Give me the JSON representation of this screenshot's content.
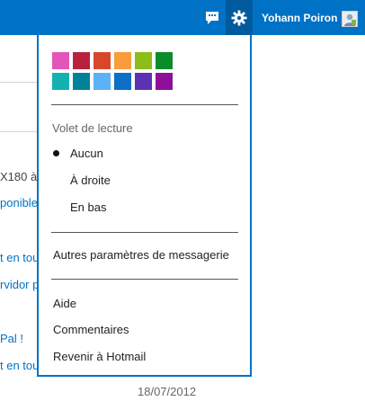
{
  "header": {
    "user_name": "Yohann Poiron"
  },
  "background": {
    "fragments": [
      "X180 à",
      "ponible",
      "t en tou",
      "rvidor p",
      "Pal !",
      "t en tou"
    ],
    "date": "18/07/2012"
  },
  "menu": {
    "theme_colors": [
      "#e355b8",
      "#b8213e",
      "#d9472b",
      "#f99c3c",
      "#8cbd18",
      "#098c29",
      "#13b2b2",
      "#018298",
      "#5cb2f5",
      "#0d6fc6",
      "#5d31b4",
      "#8e0f99"
    ],
    "reading_pane": {
      "title": "Volet de lecture",
      "options": [
        {
          "label": "Aucun",
          "selected": true
        },
        {
          "label": "À droite",
          "selected": false
        },
        {
          "label": "En bas",
          "selected": false
        }
      ]
    },
    "other_settings": "Autres paramètres de messagerie",
    "help": "Aide",
    "feedback": "Commentaires",
    "back_to_hotmail": "Revenir à Hotmail"
  }
}
